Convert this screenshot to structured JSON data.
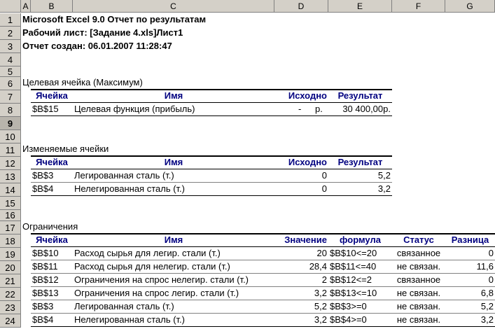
{
  "columns": [
    "A",
    "B",
    "C",
    "D",
    "E",
    "F",
    "G"
  ],
  "rows": [
    "1",
    "2",
    "3",
    "4",
    "5",
    "6",
    "7",
    "8",
    "9",
    "10",
    "11",
    "12",
    "13",
    "14",
    "15",
    "16",
    "17",
    "18",
    "19",
    "20",
    "21",
    "22",
    "23",
    "24"
  ],
  "title": {
    "line1": "Microsoft Excel 9.0 Отчет по результатам",
    "line2": "Рабочий лист: [Задание 4.xls]Лист1",
    "line3": "Отчет создан: 06.01.2007 11:28:47"
  },
  "target": {
    "heading": "Целевая ячейка (Максимум)",
    "headers": [
      "Ячейка",
      "Имя",
      "Исходно",
      "Результат"
    ],
    "row": {
      "cell": "$B$15",
      "name": "Целевая функция (прибыль)",
      "initial_dash": "-",
      "initial_unit": "р.",
      "result": "30 400,00р."
    }
  },
  "changing": {
    "heading": "Изменяемые ячейки",
    "headers": [
      "Ячейка",
      "Имя",
      "Исходно",
      "Результат"
    ],
    "rows": [
      {
        "cell": "$B$3",
        "name": "Легированная сталь (т.)",
        "initial": "0",
        "result": "5,2"
      },
      {
        "cell": "$B$4",
        "name": "Нелегированная сталь (т.)",
        "initial": "0",
        "result": "3,2"
      }
    ]
  },
  "constraints": {
    "heading": "Ограничения",
    "headers": [
      "Ячейка",
      "Имя",
      "Значение",
      "формула",
      "Статус",
      "Разница"
    ],
    "rows": [
      {
        "cell": "$B$10",
        "name": "Расход сырья для легир. стали (т.)",
        "value": "20",
        "formula": "$B$10<=20",
        "status": "связанное",
        "diff": "0"
      },
      {
        "cell": "$B$11",
        "name": "Расход сырья для нелегир. стали (т.)",
        "value": "28,4",
        "formula": "$B$11<=40",
        "status": "не связан.",
        "diff": "11,6"
      },
      {
        "cell": "$B$12",
        "name": "Ограничения на спрос нелегир. стали (т.)",
        "value": "2",
        "formula": "$B$12<=2",
        "status": "связанное",
        "diff": "0"
      },
      {
        "cell": "$B$13",
        "name": "Ограничения на спрос легир. стали (т.)",
        "value": "3,2",
        "formula": "$B$13<=10",
        "status": "не связан.",
        "diff": "6,8"
      },
      {
        "cell": "$B$3",
        "name": "Легированная сталь (т.)",
        "value": "5,2",
        "formula": "$B$3>=0",
        "status": "не связан.",
        "diff": "5,2"
      },
      {
        "cell": "$B$4",
        "name": "Нелегированная сталь (т.)",
        "value": "3,2",
        "formula": "$B$4>=0",
        "status": "не связан.",
        "diff": "3,2"
      }
    ]
  },
  "colors": {
    "header_bg": "#d4d0c8",
    "header_text": "#000080"
  }
}
